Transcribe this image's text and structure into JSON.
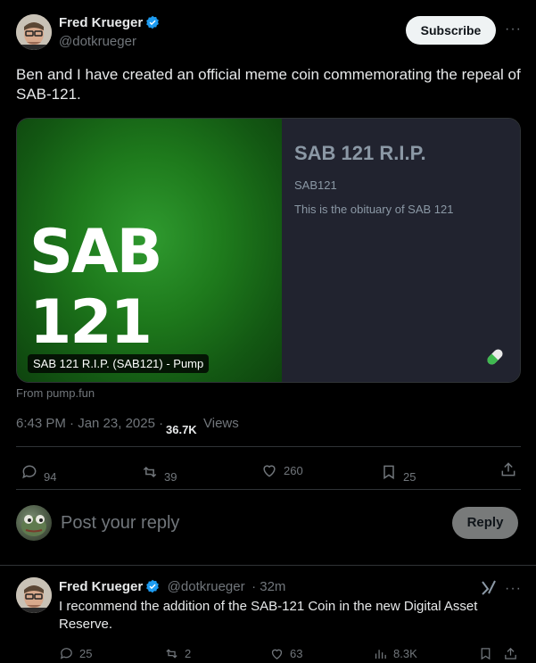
{
  "tweet": {
    "author_name": "Fred Krueger",
    "author_handle": "@dotkrueger",
    "subscribe_label": "Subscribe",
    "more_label": "···",
    "text": "Ben and I have created an official meme coin commemorating  the repeal of SAB-121.",
    "card": {
      "image_text": "SAB 121",
      "overlay_label": "SAB 121 R.I.P. (SAB121) - Pump",
      "title": "SAB 121 R.I.P.",
      "ticker": "SAB121",
      "description": "This is the obituary of SAB 121",
      "pill_icon": "pill-icon",
      "source": "From pump.fun"
    },
    "timestamp": "6:43 PM · Jan 23, 2025 ·",
    "views_count": "36.7K",
    "views_label": "Views",
    "actions": {
      "replies": "94",
      "reposts": "39",
      "likes": "260",
      "bookmarks": "25"
    }
  },
  "reply_box": {
    "placeholder": "Post your reply",
    "button_label": "Reply"
  },
  "reply": {
    "author_name": "Fred Krueger",
    "author_handle": "@dotkrueger",
    "time": "· 32m",
    "grok_icon": "grok-icon",
    "more_label": "···",
    "text": "I recommend the addition of the SAB-121 Coin in the new Digital Asset Reserve.",
    "actions": {
      "replies": "25",
      "reposts": "2",
      "likes": "63",
      "views": "8.3K"
    }
  },
  "colors": {
    "background": "#000000",
    "verified": "#1d9bf0",
    "muted": "#71767b",
    "card_green": "#1e7a1c"
  }
}
